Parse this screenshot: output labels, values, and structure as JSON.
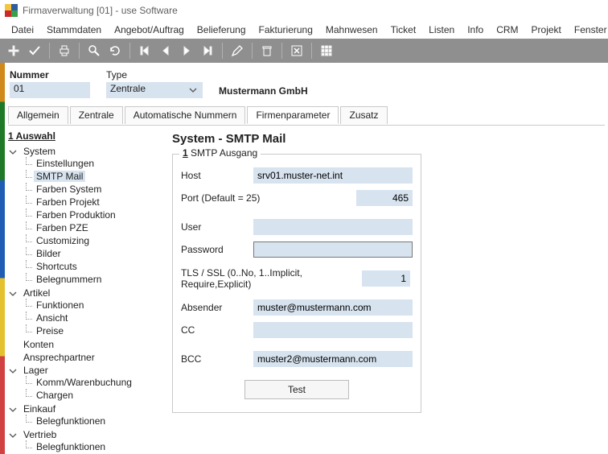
{
  "window": {
    "title": "Firmaverwaltung [01] - use Software"
  },
  "menu": {
    "items": [
      "Datei",
      "Stammdaten",
      "Angebot/Auftrag",
      "Belieferung",
      "Fakturierung",
      "Mahnwesen",
      "Ticket",
      "Listen",
      "Info",
      "CRM",
      "Projekt",
      "Fenster"
    ],
    "help": "?"
  },
  "header": {
    "number_label": "Nummer",
    "number_value": "01",
    "type_label": "Type",
    "type_value": "Zentrale",
    "company": "Mustermann GmbH"
  },
  "tabs": {
    "items": [
      "Allgemein",
      "Zentrale",
      "Automatische Nummern",
      "Firmenparameter",
      "Zusatz"
    ],
    "active_index": 3
  },
  "tree": {
    "title": "1 Auswahl",
    "root": [
      {
        "label": "System",
        "expanded": true,
        "children": [
          {
            "label": "Einstellungen"
          },
          {
            "label": "SMTP Mail",
            "selected": true
          },
          {
            "label": "Farben System"
          },
          {
            "label": "Farben Projekt"
          },
          {
            "label": "Farben Produktion"
          },
          {
            "label": "Farben PZE"
          },
          {
            "label": "Customizing"
          },
          {
            "label": "Bilder"
          },
          {
            "label": "Shortcuts"
          },
          {
            "label": "Belegnummern"
          }
        ]
      },
      {
        "label": "Artikel",
        "expanded": true,
        "children": [
          {
            "label": "Funktionen"
          },
          {
            "label": "Ansicht"
          },
          {
            "label": "Preise"
          }
        ]
      },
      {
        "label": "Konten"
      },
      {
        "label": "Ansprechpartner"
      },
      {
        "label": "Lager",
        "expanded": true,
        "children": [
          {
            "label": "Komm/Warenbuchung"
          },
          {
            "label": "Chargen"
          }
        ]
      },
      {
        "label": "Einkauf",
        "expanded": true,
        "children": [
          {
            "label": "Belegfunktionen"
          }
        ]
      },
      {
        "label": "Vertrieb",
        "expanded": true,
        "children": [
          {
            "label": "Belegfunktionen"
          }
        ]
      }
    ]
  },
  "panel": {
    "title": "System - SMTP Mail",
    "group_title_prefix": "1",
    "group_title": "SMTP Ausgang",
    "fields": {
      "host_label": "Host",
      "host_value": "srv01.muster-net.int",
      "port_label": "Port (Default = 25)",
      "port_value": "465",
      "user_label": "User",
      "user_value": "",
      "password_label": "Password",
      "password_value": "",
      "tls_label": "TLS / SSL (0..No, 1..Implicit, Require,Explicit)",
      "tls_value": "1",
      "sender_label": "Absender",
      "sender_value": "muster@mustermann.com",
      "cc_label": "CC",
      "cc_value": "",
      "bcc_label": "BCC",
      "bcc_value": "muster2@mustermann.com"
    },
    "test_button": "Test"
  },
  "toolbar_icons": [
    "plus",
    "check",
    "_sep",
    "print",
    "_sep",
    "zoom",
    "refresh",
    "_sep",
    "first",
    "prev",
    "next",
    "last",
    "_sep",
    "edit",
    "_sep",
    "trash",
    "_sep",
    "close-box",
    "_sep",
    "grid"
  ]
}
